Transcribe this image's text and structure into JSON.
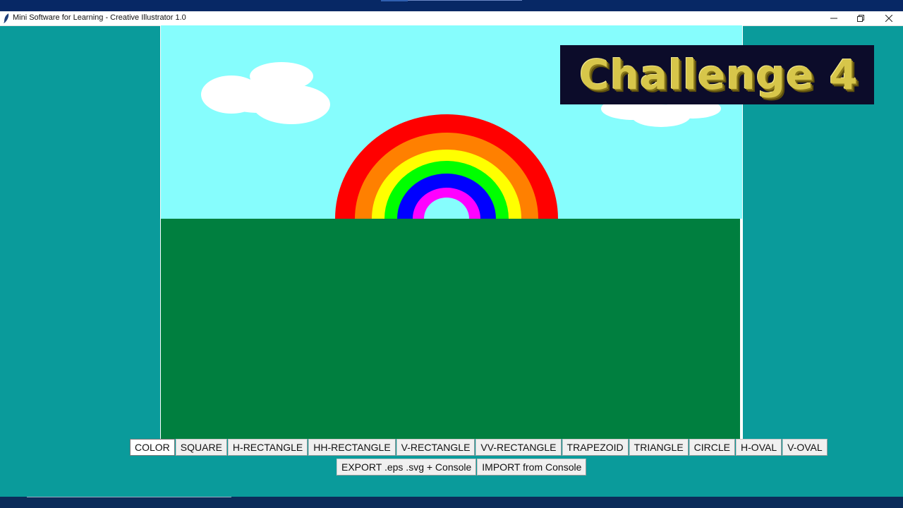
{
  "window": {
    "title": "Mini Software for Learning - Creative Illustrator 1.0",
    "controls": [
      "minimize-icon",
      "restore-icon",
      "close-icon"
    ]
  },
  "overlay": {
    "badge_text": "Challenge 4"
  },
  "toolbar": {
    "row1": [
      "COLOR",
      "SQUARE",
      "H-RECTANGLE",
      "HH-RECTANGLE",
      "V-RECTANGLE",
      "VV-RECTANGLE",
      "TRAPEZOID",
      "TRIANGLE",
      "CIRCLE",
      "H-OVAL",
      "V-OVAL"
    ],
    "row2": [
      "EXPORT .eps .svg + Console",
      "IMPORT from Console"
    ],
    "active": "COLOR"
  },
  "colors": {
    "background": "#0a9b9b",
    "sky": "#86fdfd",
    "ground": "#007f3f",
    "cloud": "#ffffff",
    "rainbow": [
      "#ff0000",
      "#ff8000",
      "#ffff00",
      "#00ff00",
      "#0000ff",
      "#ff00ff"
    ]
  }
}
